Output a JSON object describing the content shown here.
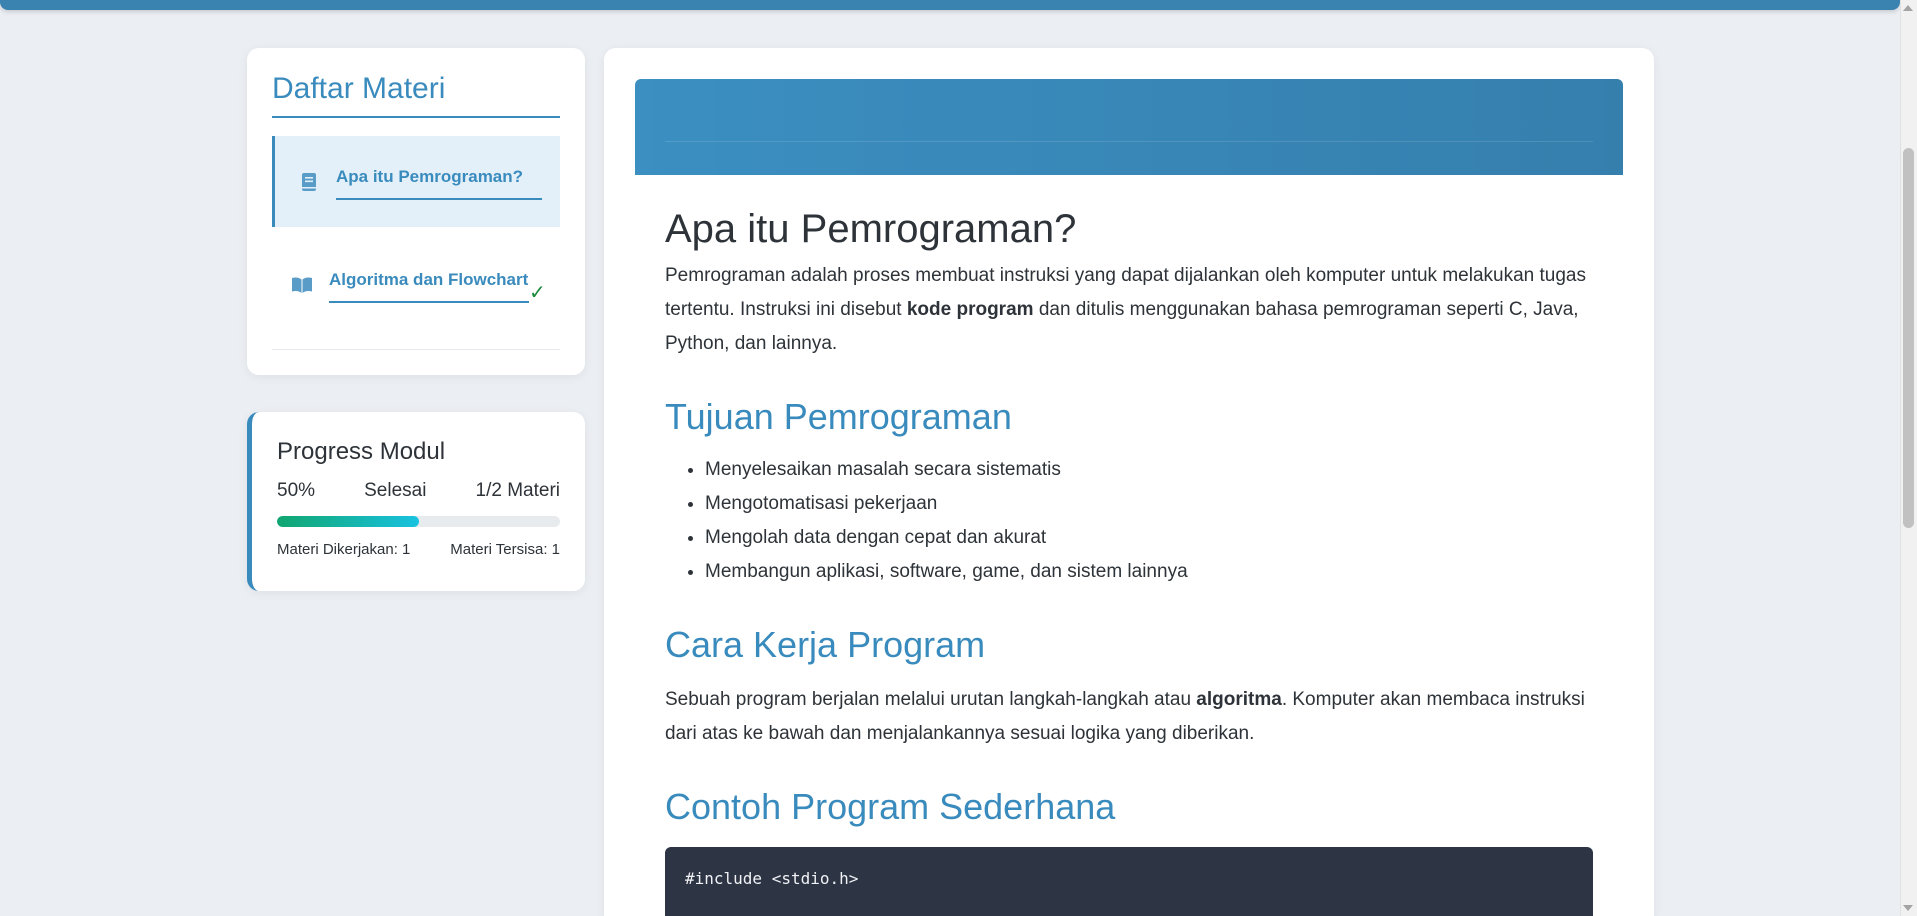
{
  "sidebar": {
    "title": "Daftar Materi",
    "lessons": [
      {
        "label": "Apa itu Pemrograman?",
        "icon": "book-icon",
        "active": true
      },
      {
        "label": "Algoritma dan Flowchart",
        "icon": "open-book-icon",
        "status_mark": "✓"
      }
    ]
  },
  "progress": {
    "title": "Progress Modul",
    "percent_label": "50%",
    "status_label": "Selesai",
    "count_label": "1/2 Materi",
    "fill_fraction": 0.5,
    "done_label": "Materi Dikerjakan: 1",
    "remaining_label": "Materi Tersisa: 1",
    "bar_colors": [
      "#10a670",
      "#19c2e0"
    ]
  },
  "content": {
    "title": "Apa itu Pemrograman?",
    "intro": {
      "before": "Pemrograman adalah proses membuat instruksi yang dapat dijalankan oleh komputer untuk melakukan tugas tertentu. Instruksi ini disebut ",
      "bold": "kode program",
      "after": " dan ditulis menggunakan bahasa pemrograman seperti C, Java, Python, dan lainnya."
    },
    "goals_heading": "Tujuan Pemrograman",
    "goals": [
      "Menyelesaikan masalah secara sistematis",
      "Mengotomatisasi pekerjaan",
      "Mengolah data dengan cepat dan akurat",
      "Membangun aplikasi, software, game, dan sistem lainnya"
    ],
    "how_heading": "Cara Kerja Program",
    "how": {
      "before": "Sebuah program berjalan melalui urutan langkah-langkah atau ",
      "bold": "algoritma",
      "after": ". Komputer akan membaca instruksi dari atas ke bawah dan menjalankannya sesuai logika yang diberikan."
    },
    "example_heading": "Contoh Program Sederhana",
    "code_line": "#include <stdio.h>"
  },
  "colors": {
    "accent": "#3a8bbd",
    "check": "#1c8a3d",
    "code_bg": "#2d3444"
  }
}
